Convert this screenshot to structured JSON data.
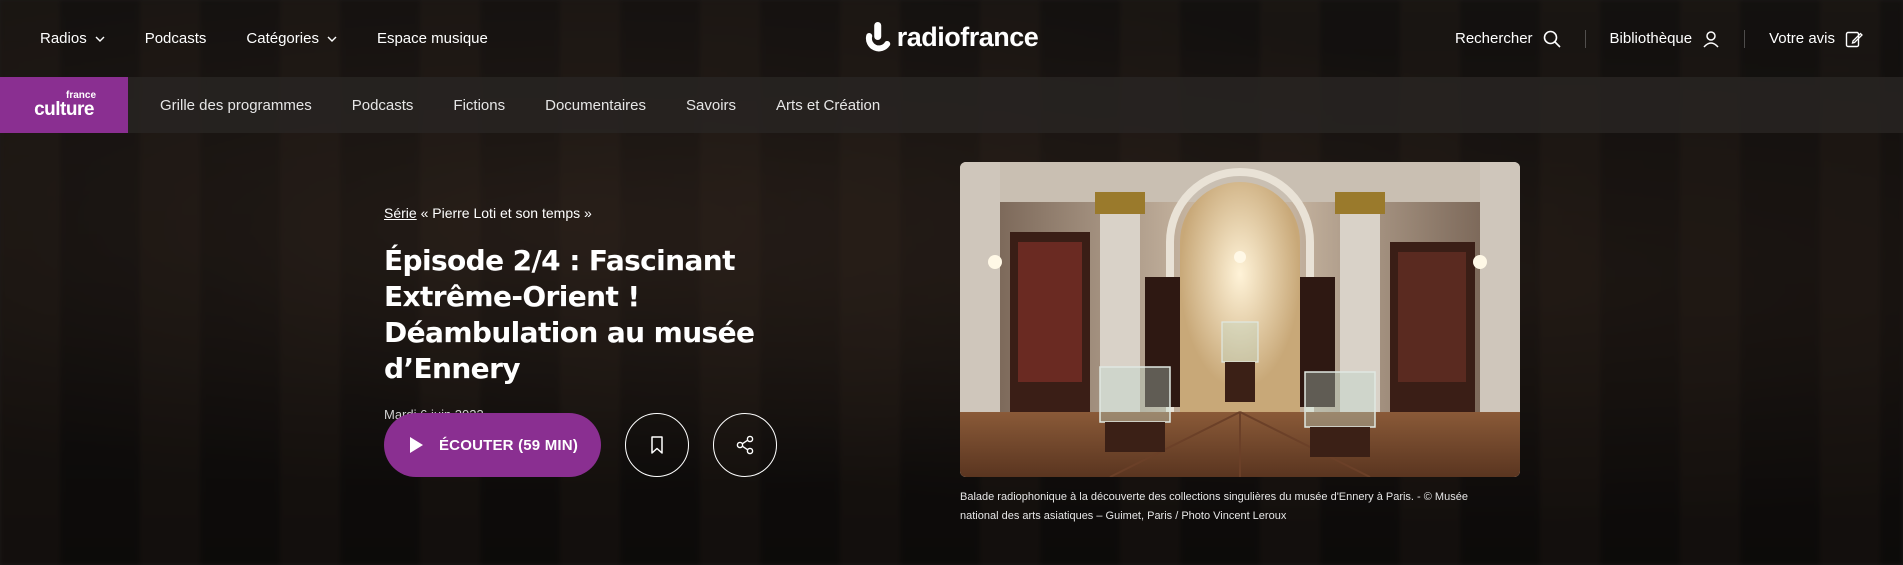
{
  "topnav": {
    "radios": "Radios",
    "podcasts": "Podcasts",
    "categories": "Catégories",
    "music": "Espace musique",
    "brand": "radiofrance",
    "search": "Rechercher",
    "library": "Bibliothèque",
    "feedback": "Votre avis"
  },
  "subnav": {
    "logo_top": "france",
    "logo_main": "culture",
    "items": [
      "Grille des programmes",
      "Podcasts",
      "Fictions",
      "Documentaires",
      "Savoirs",
      "Arts et Création"
    ]
  },
  "episode": {
    "series_link": "Série",
    "series_name": " « Pierre Loti et son temps »",
    "title": "Épisode 2/4 : Fascinant Extrême-Orient ! Déambulation au musée d’Ennery",
    "date": "Mardi 6 juin 2023",
    "listen_label": "ÉCOUTER (59 MIN)",
    "caption": "Balade radiophonique à la découverte des collections singulières du musée d'Ennery à Paris. - © Musée national des arts asiatiques – Guimet, Paris / Photo Vincent Leroux"
  },
  "colors": {
    "accent": "#8a2f91"
  },
  "icons": {
    "search": "search-icon",
    "library": "user-icon",
    "feedback": "edit-icon",
    "play": "play-icon",
    "bookmark": "bookmark-icon",
    "share": "share-icon"
  }
}
